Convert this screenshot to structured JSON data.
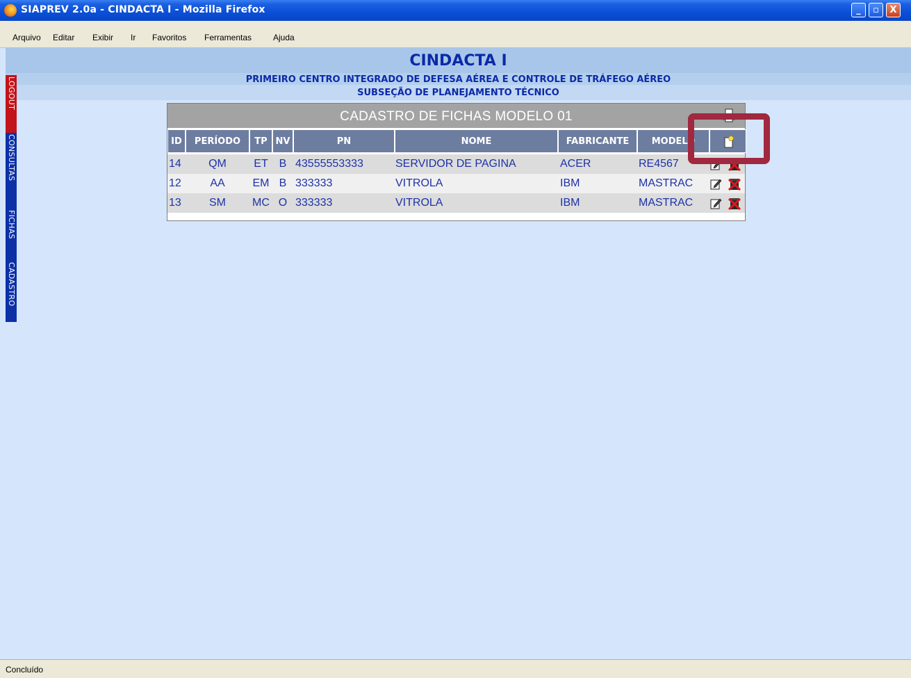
{
  "window": {
    "title": "SIAPREV 2.0a - CINDACTA I - Mozilla Firefox",
    "minimize": "_",
    "maximize": "▫",
    "close": "X"
  },
  "menu": {
    "arquivo": "Arquivo",
    "editar": "Editar",
    "exibir": "Exibir",
    "ir": "Ir",
    "favoritos": "Favoritos",
    "ferramentas": "Ferramentas",
    "ajuda": "Ajuda"
  },
  "header": {
    "title": "CINDACTA I",
    "subtitle1": "PRIMEIRO CENTRO INTEGRADO DE DEFESA AÉREA E CONTROLE DE TRÁFEGO AÉREO",
    "subtitle2": "SUBSEÇÃO DE PLANEJAMENTO TÉCNICO"
  },
  "sidebar": {
    "logout": "LOGOUT",
    "consultas": "CONSULTAS",
    "fichas": "FICHAS",
    "cadastro": "CADASTRO"
  },
  "panel": {
    "title": "CADASTRO DE FICHAS MODELO 01",
    "columns": {
      "id": "ID",
      "periodo": "PERÍODO",
      "tp": "TP",
      "nv": "NV",
      "pn": "PN",
      "nome": "NOME",
      "fabricante": "FABRICANTE",
      "modelo": "MODELO"
    },
    "rows": [
      {
        "id": "14",
        "periodo": "QM",
        "tp": "ET",
        "nv": "B",
        "pn": "43555553333",
        "nome": "SERVIDOR DE PAGINA",
        "fabricante": "ACER",
        "modelo": "RE4567"
      },
      {
        "id": "12",
        "periodo": "AA",
        "tp": "EM",
        "nv": "B",
        "pn": "333333",
        "nome": "VITROLA",
        "fabricante": "IBM",
        "modelo": "MASTRAC"
      },
      {
        "id": "13",
        "periodo": "SM",
        "tp": "MC",
        "nv": "O",
        "pn": "333333",
        "nome": "VITROLA",
        "fabricante": "IBM",
        "modelo": "MASTRAC"
      }
    ]
  },
  "status": {
    "text": "Concluído"
  },
  "colors": {
    "header_text": "#0b2aa7",
    "table_header": "#6d7da0",
    "logout_tab": "#c2141a",
    "nav_tab": "#0c30a6",
    "highlight": "#a0283f"
  }
}
